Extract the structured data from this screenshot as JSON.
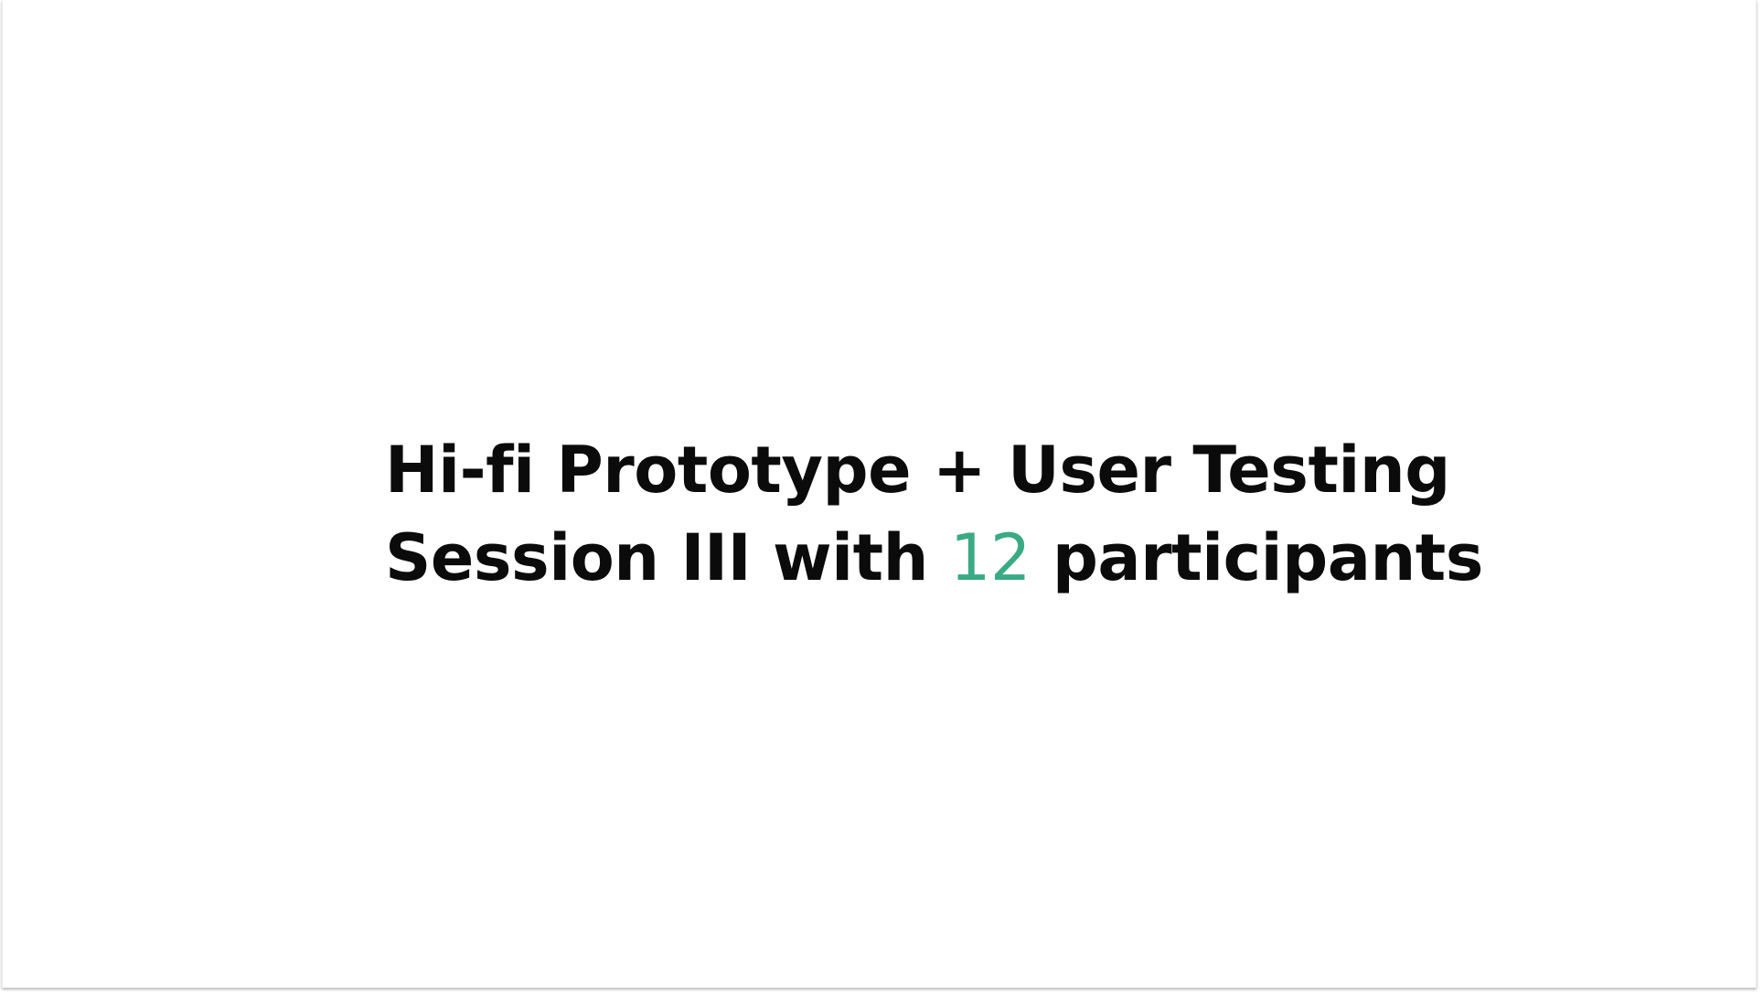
{
  "slide": {
    "headline_line1": "Hi-fi Prototype + User Testing",
    "headline_line2_prefix": "Session III with",
    "participant_count": "12",
    "headline_line2_suffix": "participants"
  },
  "colors": {
    "background": "#ffffff",
    "text": "#0b0b0b",
    "accent": "#3aaa85"
  }
}
